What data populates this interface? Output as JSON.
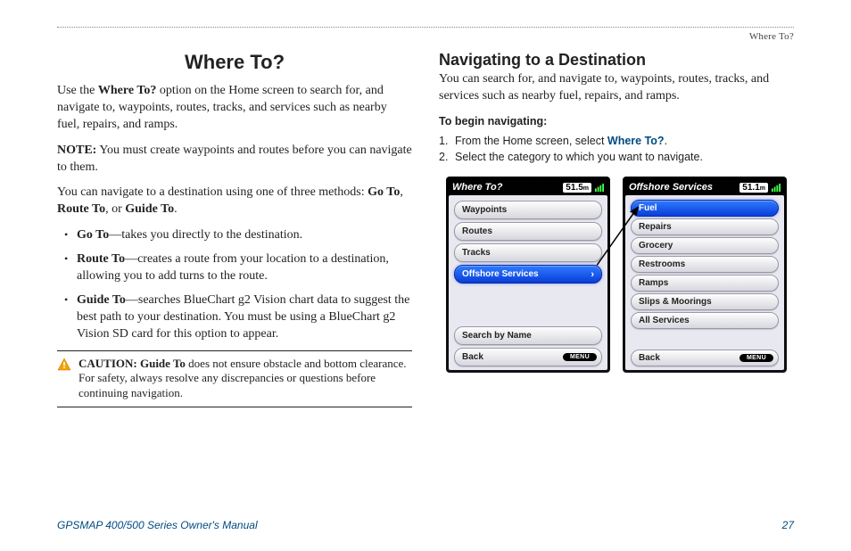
{
  "header": {
    "breadcrumb": "Where To?"
  },
  "title": "Where To?",
  "body": {
    "p1_prefix": "Use the ",
    "p1_bold": "Where To?",
    "p1_suffix": " option on the Home screen to search for, and navigate to, waypoints, routes, tracks, and services such as nearby fuel, repairs, and ramps.",
    "note_label": "NOTE:",
    "note_text": " You must create waypoints and routes before you can navigate to them.",
    "p2_prefix": "You can navigate to a destination using one of three methods: ",
    "p2_b1": "Go To",
    "p2_sep1": ", ",
    "p2_b2": "Route To",
    "p2_sep2": ", or ",
    "p2_b3": "Guide To",
    "p2_suffix": ".",
    "bullets": [
      {
        "label": "Go To",
        "text": "—takes you directly to the destination."
      },
      {
        "label": "Route To",
        "text": "—creates a route from your location to a destination, allowing you to add turns to the route."
      },
      {
        "label": "Guide To",
        "text": "—searches BlueChart g2 Vision chart data to suggest the best path to your destination. You must be using a BlueChart g2 Vision SD card for this option to appear."
      }
    ],
    "caution_label": "CAUTION: Guide To",
    "caution_text": " does not ensure obstacle and bottom clearance. For safety, always resolve any discrepancies or questions before continuing navigation."
  },
  "right": {
    "heading": "Navigating to a Destination",
    "intro": "You can search for, and navigate to, waypoints, routes, tracks, and services such as nearby fuel, repairs, and ramps.",
    "steps_heading": "To begin navigating:",
    "step1_pre": "From the Home screen, select ",
    "step1_link": "Where To?",
    "step1_post": ".",
    "step2": "Select the category to which you want to navigate."
  },
  "device1": {
    "title": "Where To?",
    "depth": "51.5",
    "depth_unit": "m",
    "items": [
      "Waypoints",
      "Routes",
      "Tracks",
      "Offshore Services"
    ],
    "selected": "Offshore Services",
    "search": "Search by Name",
    "back": "Back",
    "menu": "MENU"
  },
  "device2": {
    "title": "Offshore Services",
    "depth": "51.1",
    "depth_unit": "m",
    "items": [
      "Fuel",
      "Repairs",
      "Grocery",
      "Restrooms",
      "Ramps",
      "Slips & Moorings",
      "All Services"
    ],
    "selected": "Fuel",
    "back": "Back",
    "menu": "MENU"
  },
  "footer": {
    "left": "GPSMAP 400/500 Series Owner's Manual",
    "right": "27"
  }
}
